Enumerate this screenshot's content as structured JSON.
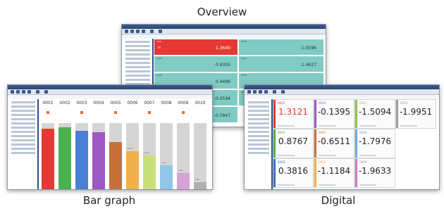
{
  "captions": {
    "overview": "Overview",
    "bar": "Bar graph",
    "digital": "Digital"
  },
  "overview": {
    "cells": [
      {
        "channel": "0001",
        "value": "1.3640",
        "alarm": "Hi",
        "color": "#e53935"
      },
      {
        "channel": "0006",
        "value": "-1.0596",
        "color": "#80cbc4"
      },
      {
        "channel": "0003",
        "value": "0.9355",
        "color": "#80cbc4"
      },
      {
        "channel": "0007",
        "value": "-1.4627",
        "color": "#80cbc4"
      },
      {
        "channel": "0004",
        "value": "0.4496",
        "color": "#80cbc4"
      },
      {
        "channel": "0008",
        "value": "",
        "color": "#80cbc4"
      },
      {
        "channel": "0005",
        "value": "-0.0594",
        "color": "#80cbc4"
      },
      {
        "channel": "0009",
        "value": "",
        "color": "#80cbc4"
      },
      {
        "channel": "",
        "value": "-0.5847",
        "color": "#80cbc4"
      }
    ]
  },
  "bar": {
    "channels": [
      "0001",
      "0002",
      "0003",
      "0004",
      "0005",
      "0006",
      "0007",
      "0008",
      "0009",
      "0010"
    ],
    "colors": [
      "#e53935",
      "#4caf50",
      "#4a7fd6",
      "#9c59c2",
      "#c8703a",
      "#f0b24a",
      "#c9e07a",
      "#8ec6ea",
      "#d6a0d8",
      "#b0b0b0"
    ],
    "levels": [
      0.92,
      0.94,
      0.89,
      0.86,
      0.72,
      0.58,
      0.52,
      0.38,
      0.26,
      0.12
    ],
    "readouts": [
      "",
      "",
      "",
      "",
      "",
      "-0.0594",
      "-0.5546",
      "-0.9075",
      "-1.1069",
      "-1.9047"
    ]
  },
  "digital": {
    "cells": [
      {
        "channel": "0001",
        "value": "1.3121",
        "color": "#e53935",
        "value_color": "#e53935"
      },
      {
        "channel": "0004",
        "value": "-0.1395",
        "color": "#9c59c2",
        "value_color": "#222222"
      },
      {
        "channel": "0007",
        "value": "-1.5094",
        "color": "#8bc34a",
        "value_color": "#222222"
      },
      {
        "channel": "0010",
        "value": "-1.9951",
        "color": "#9e9e9e",
        "value_color": "#222222"
      },
      {
        "channel": "0002",
        "value": "0.8767",
        "color": "#4caf50",
        "value_color": "#222222"
      },
      {
        "channel": "0005",
        "value": "-0.6511",
        "color": "#c8703a",
        "value_color": "#222222"
      },
      {
        "channel": "0008",
        "value": "-1.7976",
        "color": "#6aa8e0",
        "value_color": "#222222"
      },
      {
        "channel": "0003",
        "value": "0.3816",
        "color": "#3f6cc9",
        "value_color": "#222222"
      },
      {
        "channel": "0006",
        "value": "-1.1184",
        "color": "#f0b24a",
        "value_color": "#222222"
      },
      {
        "channel": "0009",
        "value": "-1.9633",
        "color": "#c678c9",
        "value_color": "#222222"
      }
    ]
  }
}
